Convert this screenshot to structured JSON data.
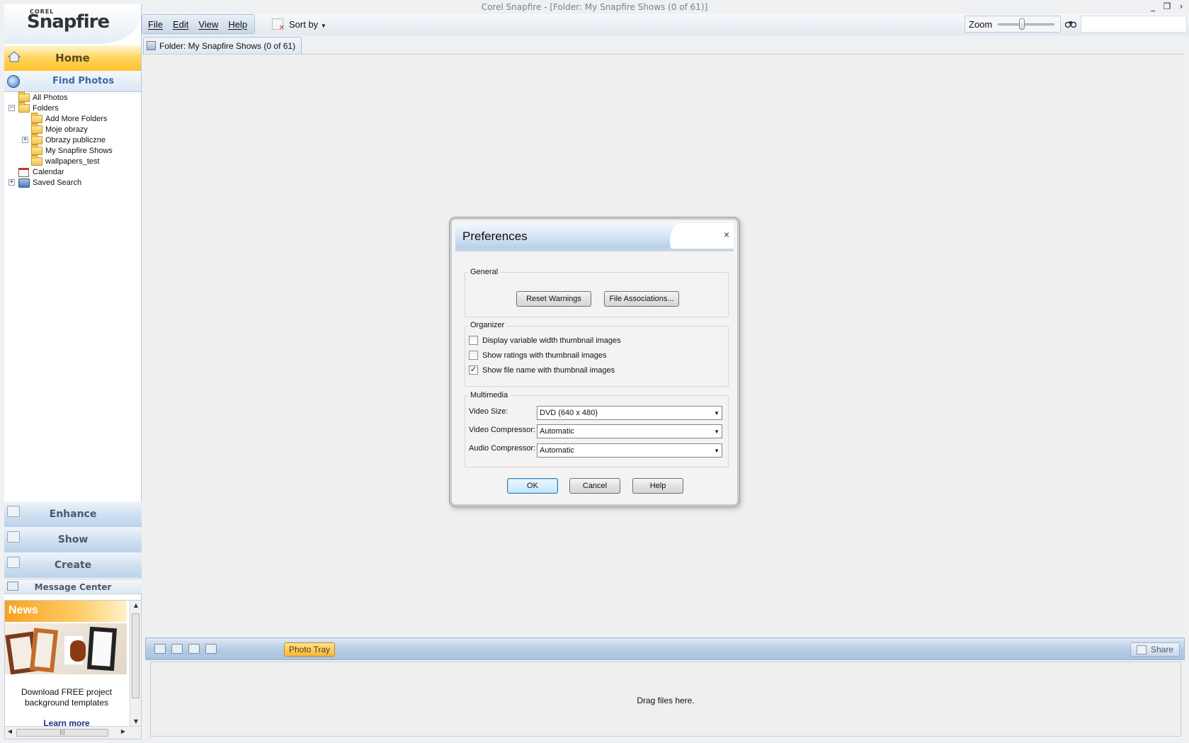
{
  "window": {
    "title": "Corel Snapfire - [Folder: My Snapfire Shows (0 of 61)]",
    "controls": [
      "_",
      "❐",
      "›"
    ]
  },
  "brand": {
    "corel": "COREL",
    "name": "Snapfire"
  },
  "sidebar": {
    "home": "Home",
    "find_photos": "Find Photos",
    "tree": {
      "all_photos": "All Photos",
      "folders": "Folders",
      "add_more_folders": "Add More Folders",
      "moje_obrazy": "Moje obrazy",
      "obrazy_publiczne": "Obrazy publiczne",
      "my_snapfire_shows": "My Snapfire Shows",
      "wallpapers_test": "wallpapers_test",
      "calendar": "Calendar",
      "saved_search": "Saved Search"
    },
    "nav": {
      "enhance": "Enhance",
      "show": "Show",
      "create": "Create",
      "message_center": "Message Center"
    },
    "news": {
      "title": "News",
      "text": "Download FREE project background templates",
      "link": "Learn more"
    }
  },
  "menubar": {
    "file": "File",
    "edit": "Edit",
    "view": "View",
    "help": "Help"
  },
  "toolbar": {
    "sort_by": "Sort by",
    "zoom": "Zoom",
    "search_placeholder": ""
  },
  "folder_tab": "Folder: My Snapfire Shows (0 of 61)",
  "tray": {
    "label": "Photo Tray",
    "share": "Share",
    "drop_hint": "Drag files here."
  },
  "dialog": {
    "title": "Preferences",
    "close": "×",
    "general": {
      "label": "General",
      "reset_warnings": "Reset Warnings",
      "file_associations": "File Associations..."
    },
    "organizer": {
      "label": "Organizer",
      "options": [
        {
          "label": "Display variable width thumbnail images",
          "checked": false
        },
        {
          "label": "Show ratings with thumbnail images",
          "checked": false
        },
        {
          "label": "Show file name with thumbnail images",
          "checked": true
        }
      ]
    },
    "multimedia": {
      "label": "Multimedia",
      "video_size_label": "Video Size:",
      "video_size_value": "DVD (640 x 480)",
      "video_compressor_label": "Video Compressor:",
      "video_compressor_value": "Automatic",
      "audio_compressor_label": "Audio Compressor:",
      "audio_compressor_value": "Automatic"
    },
    "buttons": {
      "ok": "OK",
      "cancel": "Cancel",
      "help": "Help"
    }
  },
  "colors": {
    "accent_orange": "#ffc12a",
    "accent_blue": "#3a6aa6",
    "dialog_bg": "#f3f3f3"
  }
}
